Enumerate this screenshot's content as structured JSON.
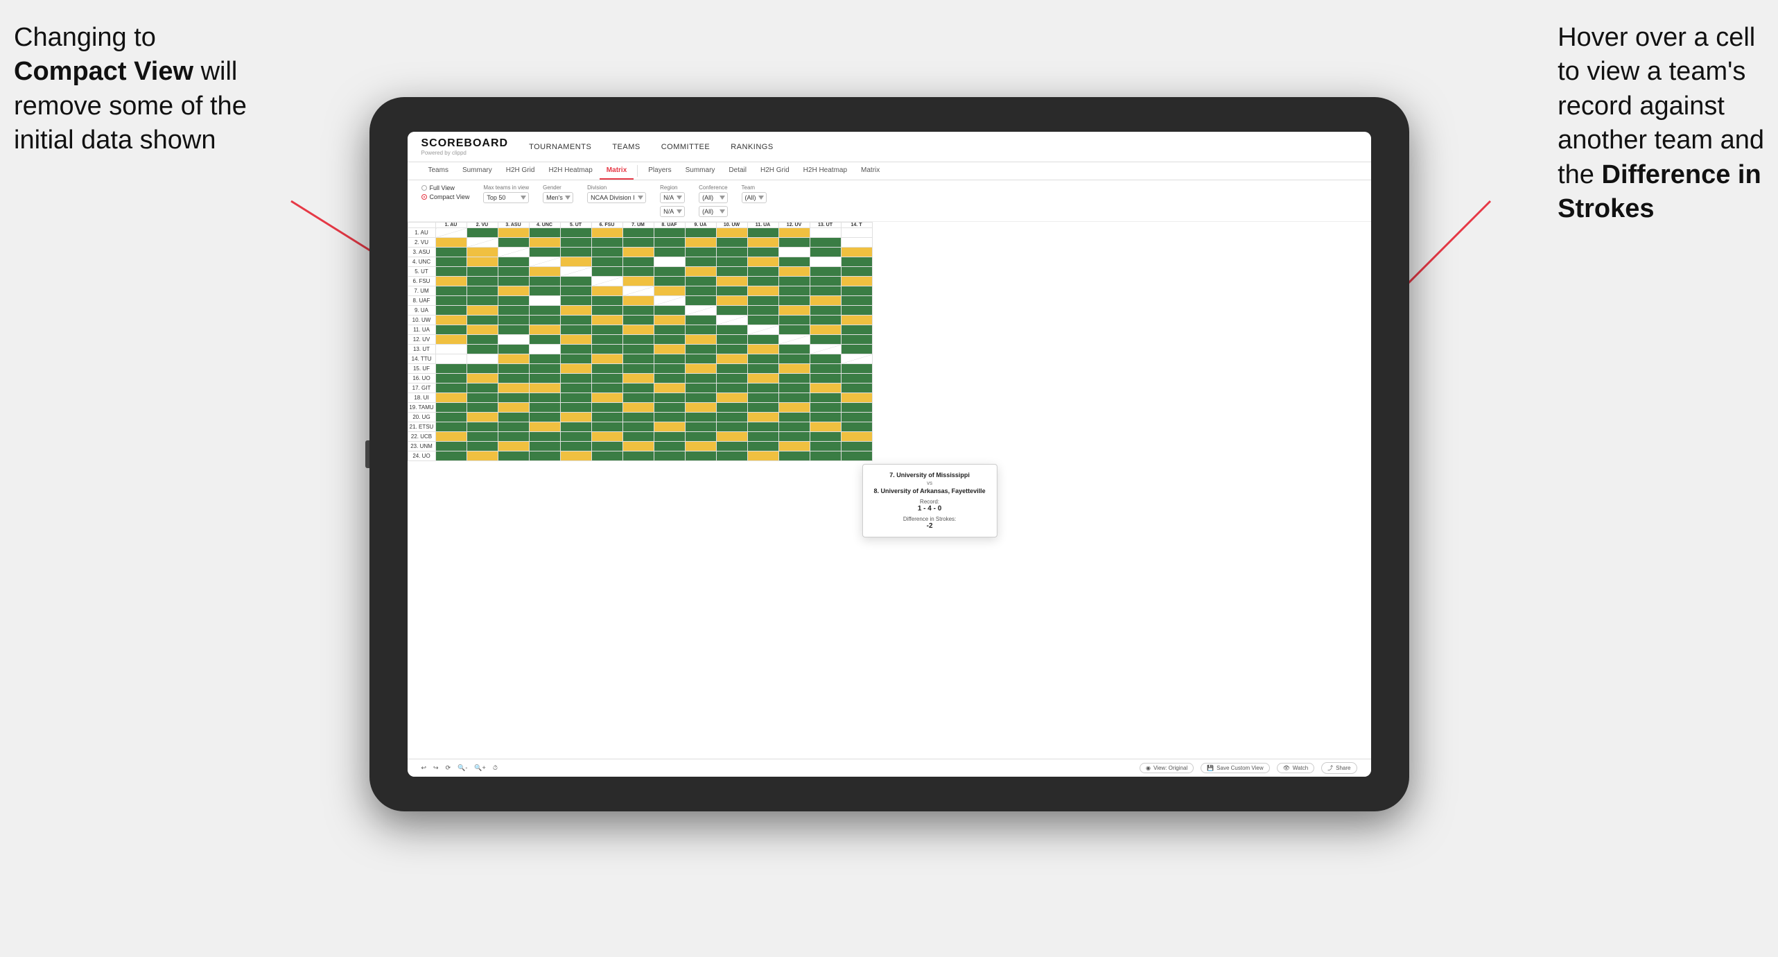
{
  "annotations": {
    "left": {
      "line1": "Changing to",
      "line2_bold": "Compact View",
      "line2_rest": " will",
      "line3": "remove some of the",
      "line4": "initial data shown"
    },
    "right": {
      "line1": "Hover over a cell",
      "line2": "to view a team's",
      "line3": "record against",
      "line4": "another team and",
      "line5_prefix": "the ",
      "line5_bold": "Difference in",
      "line6_bold": "Strokes"
    }
  },
  "nav": {
    "logo": "SCOREBOARD",
    "powered_by": "Powered by clippd",
    "items": [
      "TOURNAMENTS",
      "TEAMS",
      "COMMITTEE",
      "RANKINGS"
    ]
  },
  "sub_nav_groups": [
    {
      "tabs": [
        "Teams",
        "Summary",
        "H2H Grid",
        "H2H Heatmap",
        "Matrix"
      ]
    },
    {
      "tabs": [
        "Players",
        "Summary",
        "Detail",
        "H2H Grid",
        "H2H Heatmap",
        "Matrix"
      ]
    }
  ],
  "active_tab": "Matrix",
  "filters": {
    "view_label": "",
    "full_view": "Full View",
    "compact_view": "Compact View",
    "max_teams_label": "Max teams in view",
    "max_teams_value": "Top 50",
    "gender_label": "Gender",
    "gender_value": "Men's",
    "division_label": "Division",
    "division_value": "NCAA Division I",
    "region_label": "Region",
    "region_value": "N/A",
    "conference_label": "Conference",
    "conference_value": "(All)",
    "conference_value2": "(All)",
    "team_label": "Team",
    "team_value": "(All)"
  },
  "col_headers": [
    "1. AU",
    "2. VU",
    "3. ASU",
    "4. UNC",
    "5. UT",
    "6. FSU",
    "7. UM",
    "8. UAF",
    "9. UA",
    "10. UW",
    "11. UA",
    "12. UV",
    "13. UT",
    "14. T"
  ],
  "row_labels": [
    "1. AU",
    "2. VU",
    "3. ASU",
    "4. UNC",
    "5. UT",
    "6. FSU",
    "7. UM",
    "8. UAF",
    "9. UA",
    "10. UW",
    "11. UA",
    "12. UV",
    "13. UT",
    "14. TTU",
    "15. UF",
    "16. UO",
    "17. GIT",
    "18. UI",
    "19. TAMU",
    "20. UG",
    "21. ETSU",
    "22. UCB",
    "23. UNM",
    "24. UO"
  ],
  "tooltip": {
    "team1": "7. University of Mississippi",
    "vs": "vs",
    "team2": "8. University of Arkansas, Fayetteville",
    "record_label": "Record:",
    "record_value": "1 - 4 - 0",
    "diff_label": "Difference in Strokes:",
    "diff_value": "-2"
  },
  "toolbar": {
    "view_original": "View: Original",
    "save_custom": "Save Custom View",
    "watch": "Watch",
    "share": "Share"
  }
}
